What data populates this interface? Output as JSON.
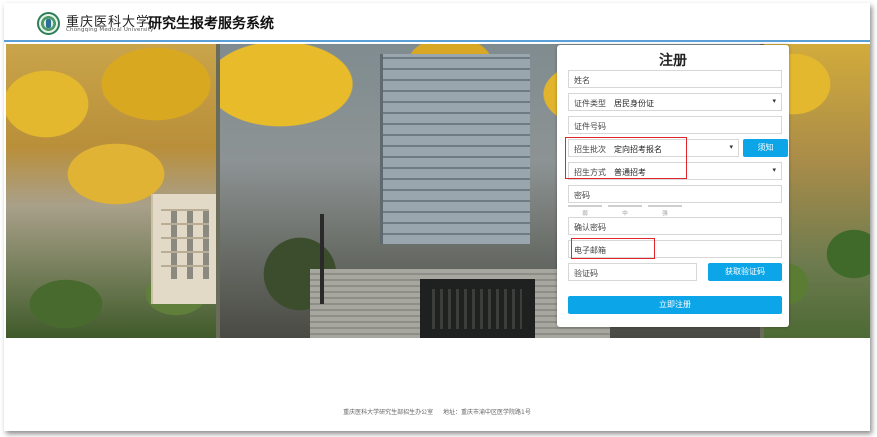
{
  "header": {
    "university_cn": "重庆医科大学",
    "university_en": "Chongqing Medical University",
    "system_title": "研究生报考服务系统"
  },
  "register": {
    "title": "注册",
    "name_placeholder": "姓名",
    "id_type_label": "证件类型",
    "id_type_value": "居民身份证",
    "id_number_placeholder": "证件号码",
    "batch_label": "招生批次",
    "batch_value": "定向招考报名",
    "notice_button": "须知",
    "method_label": "招生方式",
    "method_value": "普通招考",
    "password_placeholder": "密码",
    "strength": [
      "弱",
      "中",
      "强"
    ],
    "confirm_password_placeholder": "确认密码",
    "email_placeholder": "电子邮箱",
    "captcha_placeholder": "验证码",
    "get_code_button": "获取验证码",
    "submit_button": "立即注册"
  },
  "footer": {
    "office": "重庆医科大学研究生部招生办公室",
    "address": "地址：重庆市渝中区医学院路1号"
  },
  "colors": {
    "accent": "#0ca6e8",
    "highlight": "#e0262a",
    "header_line": "#5a9fd6"
  },
  "icons": {
    "dropdown": "caret-down-icon",
    "logo": "university-seal-icon"
  }
}
